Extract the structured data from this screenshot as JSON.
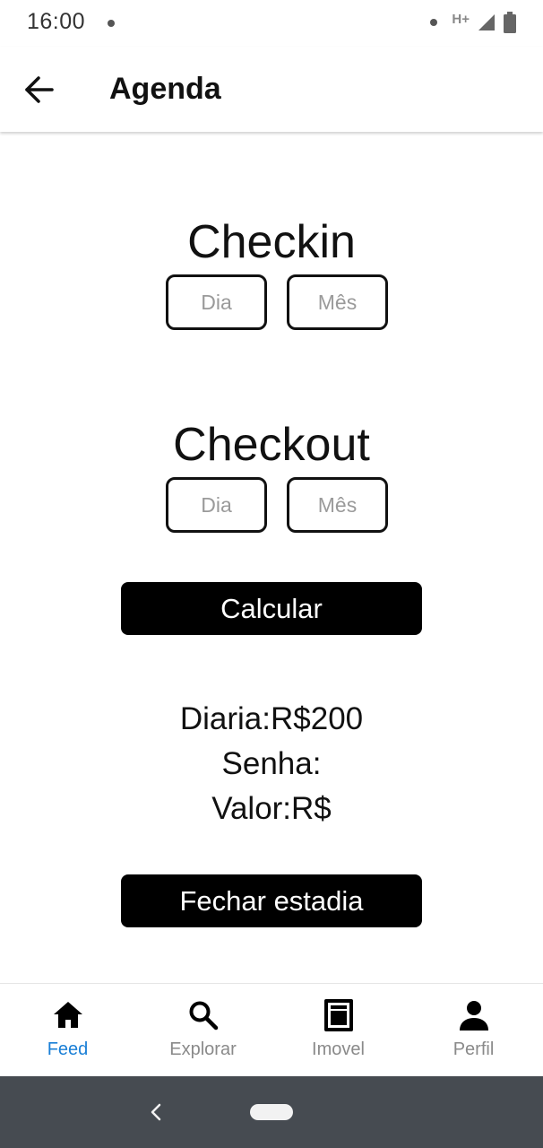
{
  "status_bar": {
    "time": "16:00",
    "network": "H+"
  },
  "app_bar": {
    "title": "Agenda",
    "back_icon": "arrow-left-icon"
  },
  "checkin": {
    "title": "Checkin",
    "day_placeholder": "Dia",
    "month_placeholder": "Mês"
  },
  "checkout": {
    "title": "Checkout",
    "day_placeholder": "Dia",
    "month_placeholder": "Mês"
  },
  "calculate_button": "Calcular",
  "info": {
    "daily_rate": "Diaria:R$200",
    "password": "Senha:",
    "value": "Valor:R$"
  },
  "close_stay_button": "Fechar estadia",
  "bottom_nav": {
    "items": [
      {
        "label": "Feed",
        "icon": "home-icon",
        "active": true
      },
      {
        "label": "Explorar",
        "icon": "search-icon",
        "active": false
      },
      {
        "label": "Imovel",
        "icon": "building-icon",
        "active": false
      },
      {
        "label": "Perfil",
        "icon": "person-icon",
        "active": false
      }
    ]
  },
  "colors": {
    "accent": "#1a7fd6",
    "inactive": "#8a8a8a",
    "button_bg": "#000000",
    "system_nav_bg": "#464b51"
  }
}
